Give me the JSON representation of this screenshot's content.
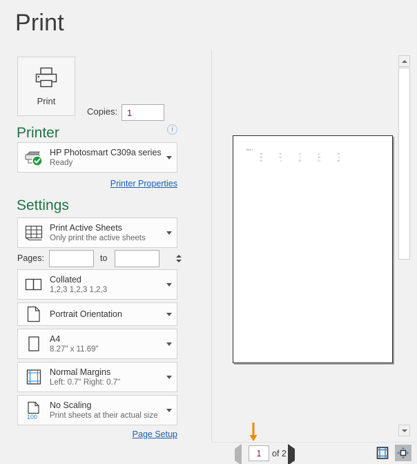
{
  "header": {
    "title": "Print"
  },
  "print_action": {
    "label": "Print",
    "icon": "printer-icon"
  },
  "copies": {
    "label": "Copies:",
    "value": "1"
  },
  "printer": {
    "heading": "Printer",
    "info_icon": "i",
    "name": "HP Photosmart C309a series",
    "status": "Ready",
    "properties_link": "Printer Properties"
  },
  "settings": {
    "heading": "Settings",
    "pages": {
      "label": "Pages:",
      "from": "",
      "to": "",
      "to_label": "to"
    },
    "page_setup_link": "Page Setup",
    "items": [
      {
        "name": "print-range",
        "title": "Print Active Sheets",
        "subtitle": "Only print the active sheets",
        "icon": "sheets-grid-icon"
      },
      {
        "name": "collation",
        "title": "Collated",
        "subtitle": "1,2,3   1,2,3   1,2,3",
        "icon": "collate-icon"
      },
      {
        "name": "orientation",
        "title": "Portrait Orientation",
        "subtitle": "",
        "icon": "portrait-page-icon"
      },
      {
        "name": "paper-size",
        "title": "A4",
        "subtitle": "8.27\" x 11.69\"",
        "icon": "paper-size-icon"
      },
      {
        "name": "margins",
        "title": "Normal Margins",
        "subtitle": "Left:  0.7\"   Right:  0.7\"",
        "icon": "margins-grid-icon"
      },
      {
        "name": "scaling",
        "title": "No Scaling",
        "subtitle": "Print sheets at their actual size",
        "icon": "scaling-icon"
      }
    ]
  },
  "preview": {
    "sheet_title": "Table 1",
    "rows": [
      [
        "48",
        "36",
        "11",
        "27",
        "94"
      ],
      [
        "49",
        "44",
        "2",
        "55",
        "8"
      ],
      [
        "63",
        "4",
        "38",
        "51",
        "88"
      ]
    ]
  },
  "statusbar": {
    "current_page": "1",
    "of_label": "of 2",
    "show_margins_title": "Show Margins",
    "zoom_page_title": "Zoom to Page"
  },
  "colors": {
    "accent_green": "#217346",
    "link_blue": "#1a5fb4",
    "value_purple": "#6b2160",
    "annotation_orange": "#ED8B00"
  }
}
